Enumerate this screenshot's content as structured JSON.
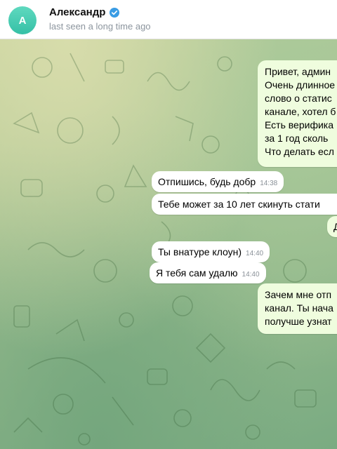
{
  "header": {
    "avatar_letter": "A",
    "name": "Александр",
    "status": "last seen a long time ago",
    "avatar_color": "#3cc8ad",
    "verified_color": "#3a9ce4"
  },
  "messages": {
    "out1": {
      "lines": [
        "Привет, админ",
        "Очень длинное",
        "слово о статис",
        "канале, хотел б",
        "Есть верифика",
        "за 1 год сколь",
        "Что делать есл"
      ]
    },
    "in1": {
      "text": "Отпишись, будь добр",
      "time": "14:38"
    },
    "in2": {
      "text": "Тебе может за 10 лет скинуть стати"
    },
    "out2": {
      "text": "Д"
    },
    "in3": {
      "text": "Ты внатуре клоун)",
      "time": "14:40"
    },
    "in4": {
      "text": "Я тебя сам удалю",
      "time": "14:40"
    },
    "out3": {
      "lines": [
        "Зачем мне отп",
        "канал. Ты нача",
        "получше узнат"
      ]
    }
  }
}
